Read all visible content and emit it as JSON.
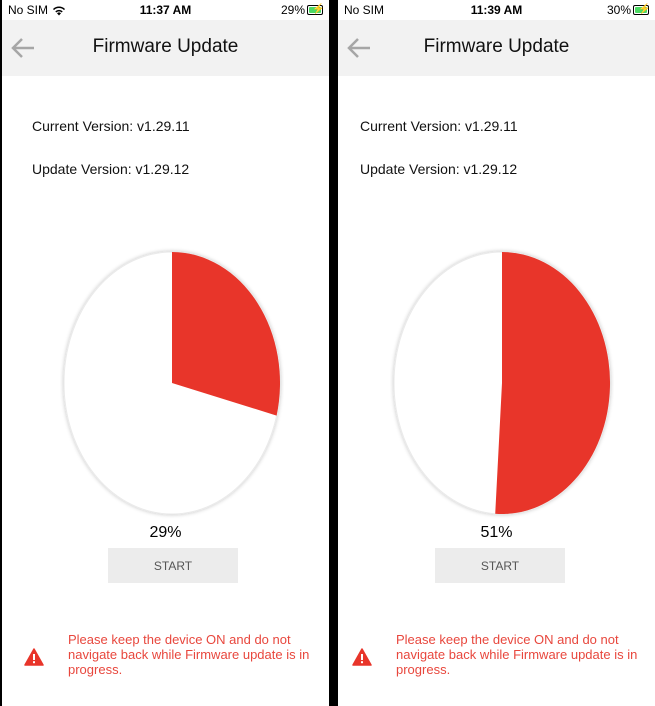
{
  "colors": {
    "accent": "#e8352a",
    "pie_bg": "#ffffff",
    "warning_text": "#e8473d",
    "button_bg": "#ececec"
  },
  "icons": {
    "back": "arrow-left-icon",
    "warning": "warning-triangle-icon",
    "wifi": "wifi-icon",
    "battery": "battery-charging-icon"
  },
  "screens": [
    {
      "status": {
        "carrier": "No SIM",
        "time": "11:37 AM",
        "battery": "29%",
        "wifi": true
      },
      "header": {
        "title": "Firmware Update"
      },
      "current_version": "Current Version: v1.29.11",
      "update_version": "Update Version: v1.29.12",
      "progress": 0.29,
      "progress_label": "29%",
      "start_label": "START",
      "warning": "Please keep the device ON and do not navigate back while Firmware update is in progress."
    },
    {
      "status": {
        "carrier": "No SIM",
        "time": "11:39 AM",
        "battery": "30%",
        "wifi": false
      },
      "header": {
        "title": "Firmware Update"
      },
      "current_version": "Current Version: v1.29.11",
      "update_version": "Update Version: v1.29.12",
      "progress": 0.51,
      "progress_label": "51%",
      "start_label": "START",
      "warning": "Please keep the device ON and do not navigate back while Firmware update is in progress."
    }
  ]
}
